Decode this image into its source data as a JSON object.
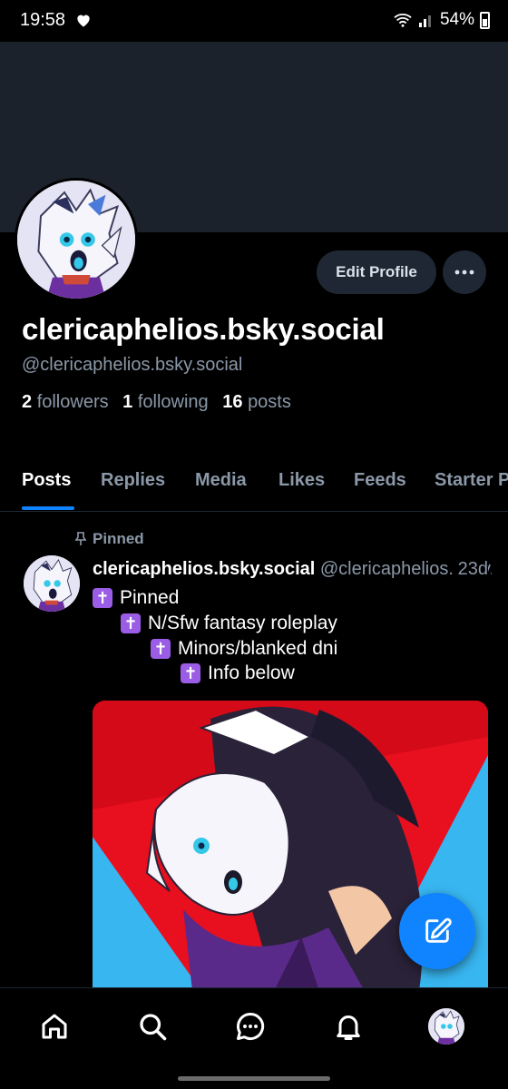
{
  "status_bar": {
    "time": "19:58",
    "battery": "54%",
    "icons": [
      "heart-icon",
      "wifi-icon",
      "signal-icon",
      "battery-icon"
    ]
  },
  "profile": {
    "edit_label": "Edit Profile",
    "display_name": "clericaphelios.bsky.social",
    "handle": "@clericaphelios.bsky.social",
    "followers_count": "2",
    "followers_label": "followers",
    "following_count": "1",
    "following_label": "following",
    "posts_count": "16",
    "posts_label": "posts"
  },
  "tabs": [
    {
      "label": "Posts",
      "active": true
    },
    {
      "label": "Replies",
      "active": false
    },
    {
      "label": "Media",
      "active": false
    },
    {
      "label": "Likes",
      "active": false
    },
    {
      "label": "Feeds",
      "active": false
    },
    {
      "label": "Starter Packs",
      "active": false
    }
  ],
  "post": {
    "pinned_label": "Pinned",
    "author_name": "clericaphelios.bsky.social",
    "author_handle": "@clericaphelios.bsky.social",
    "date": "23d",
    "lines": [
      {
        "symbol": "✝",
        "text": "Pinned"
      },
      {
        "symbol": "✝",
        "text": "N/Sfw fantasy roleplay"
      },
      {
        "symbol": "✝",
        "text": "Minors/blanked dni"
      },
      {
        "symbol": "✝",
        "text": "Info below"
      }
    ]
  },
  "bottom_nav": [
    "home-icon",
    "search-icon",
    "chat-icon",
    "bell-icon",
    "profile-avatar"
  ],
  "colors": {
    "background": "#000000",
    "banner": "#1b222b",
    "accent": "#1083fe",
    "muted_text": "#8b98a8",
    "button_bg": "#1e2733",
    "cross_emoji": "#9b5de5"
  }
}
